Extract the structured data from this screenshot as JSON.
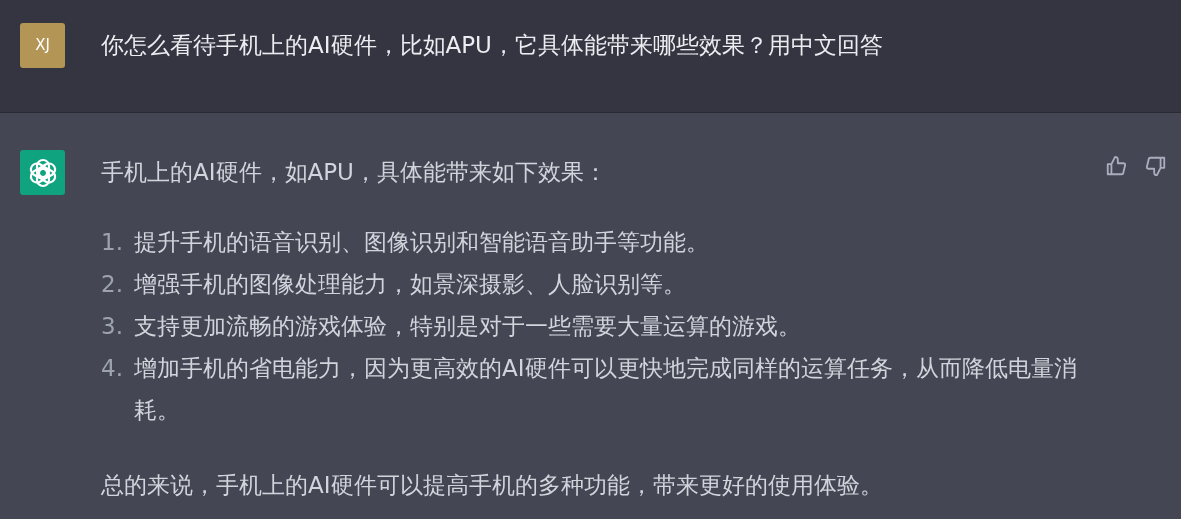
{
  "user_message": {
    "avatar_initials": "XJ",
    "text": "你怎么看待手机上的AI硬件，比如APU，它具体能带来哪些效果？用中文回答"
  },
  "assistant_message": {
    "intro": "手机上的AI硬件，如APU，具体能带来如下效果：",
    "list": [
      {
        "number": "1.",
        "text": "提升手机的语音识别、图像识别和智能语音助手等功能。"
      },
      {
        "number": "2.",
        "text": "增强手机的图像处理能力，如景深摄影、人脸识别等。"
      },
      {
        "number": "3.",
        "text": "支持更加流畅的游戏体验，特别是对于一些需要大量运算的游戏。"
      },
      {
        "number": "4.",
        "text": "增加手机的省电能力，因为更高效的AI硬件可以更快地完成同样的运算任务，从而降低电量消耗。"
      }
    ],
    "conclusion": "总的来说，手机上的AI硬件可以提高手机的多种功能，带来更好的使用体验。"
  }
}
